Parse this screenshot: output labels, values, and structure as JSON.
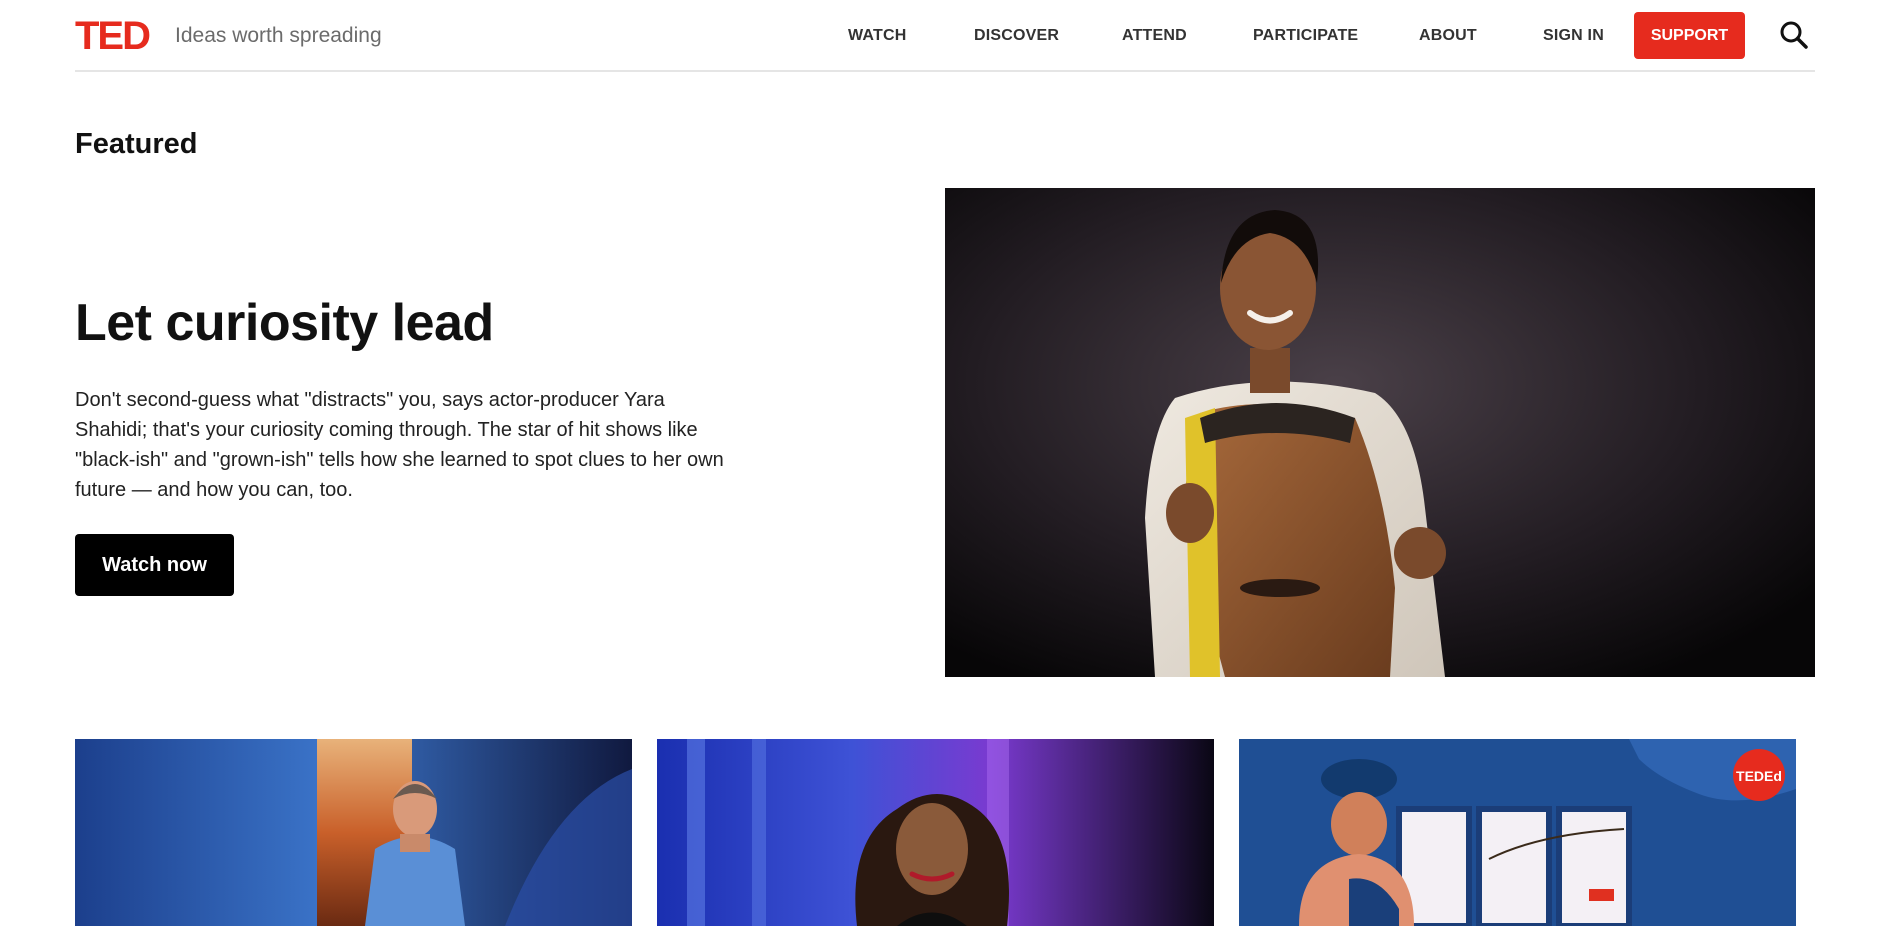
{
  "header": {
    "logo": "TED",
    "tagline": "Ideas worth spreading",
    "nav": [
      "WATCH",
      "DISCOVER",
      "ATTEND",
      "PARTICIPATE",
      "ABOUT",
      "SIGN IN"
    ],
    "support_label": "SUPPORT"
  },
  "featured": {
    "section_title": "Featured",
    "title": "Let curiosity lead",
    "description": "Don't second-guess what \"distracts\" you, says actor-producer Yara Shahidi; that's your curiosity coming through. The star of hit shows like \"black-ish\" and \"grown-ish\" tells how she learned to spot clues to her own future — and how you can, too.",
    "cta_label": "Watch now"
  },
  "cards": {
    "ted_ed_badge": "TEDEd"
  },
  "colors": {
    "brand_red": "#e62b1e",
    "button_black": "#000000"
  }
}
